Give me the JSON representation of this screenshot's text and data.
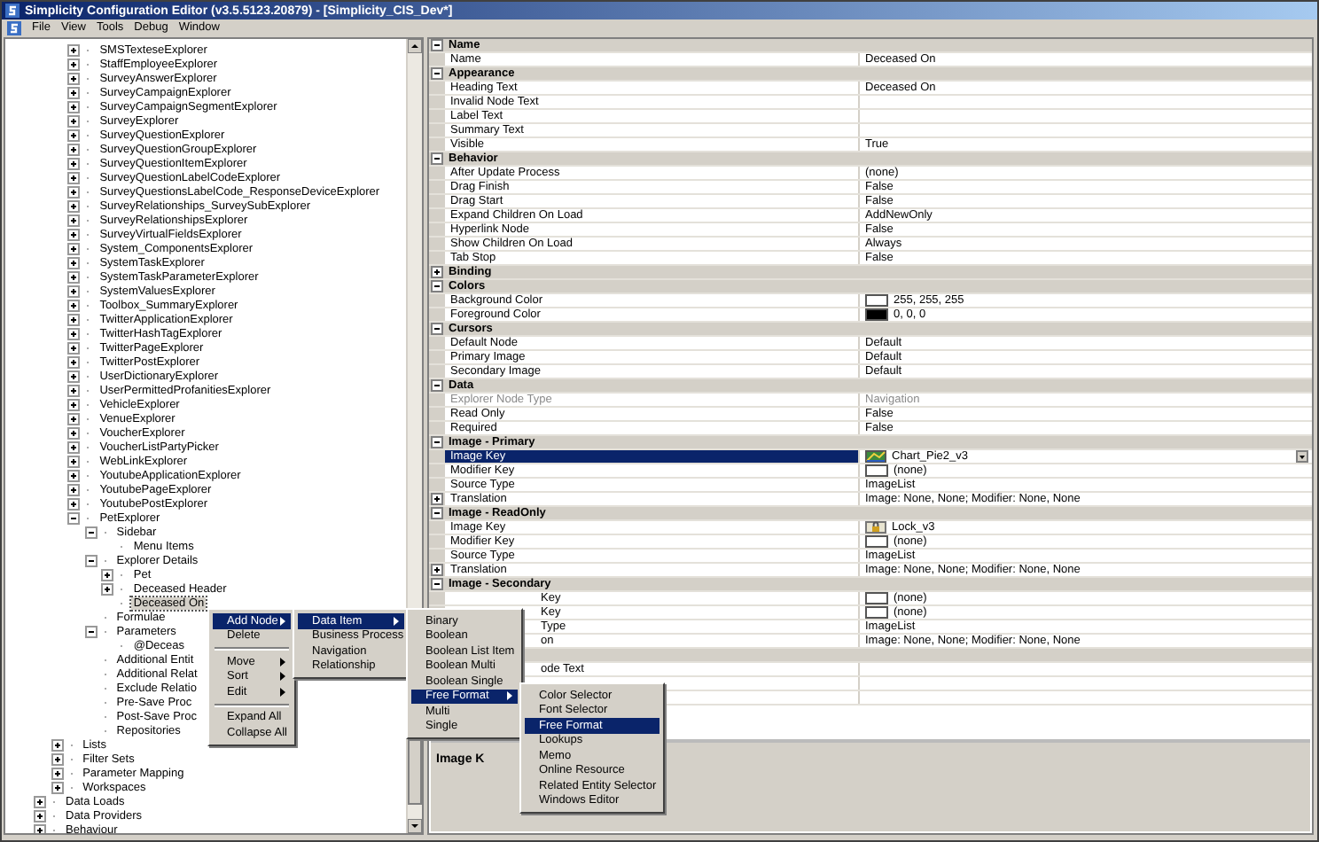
{
  "window": {
    "title": "Simplicity Configuration Editor (v3.5.5123.20879) - [Simplicity_CIS_Dev*]"
  },
  "menu_bar": [
    "File",
    "View",
    "Tools",
    "Debug",
    "Window"
  ],
  "tree": {
    "items": [
      {
        "children": [
          {
            "children": [
              {
                "label": "SMSTexteseExplorer",
                "expanded": false,
                "selected": false
              },
              {
                "label": "StaffEmployeeExplorer",
                "expanded": false,
                "selected": false
              },
              {
                "label": "SurveyAnswerExplorer",
                "expanded": false,
                "selected": false
              },
              {
                "label": "SurveyCampaignExplorer",
                "expanded": false,
                "selected": false
              },
              {
                "label": "SurveyCampaignSegmentExplorer",
                "expanded": false,
                "selected": false
              },
              {
                "label": "SurveyExplorer",
                "expanded": false,
                "selected": false
              },
              {
                "label": "SurveyQuestionExplorer",
                "expanded": false,
                "selected": false
              },
              {
                "label": "SurveyQuestionGroupExplorer",
                "expanded": false,
                "selected": false
              },
              {
                "label": "SurveyQuestionItemExplorer",
                "expanded": false,
                "selected": false
              },
              {
                "label": "SurveyQuestionLabelCodeExplorer",
                "expanded": false,
                "selected": false
              },
              {
                "label": "SurveyQuestionsLabelCode_ResponseDeviceExplorer",
                "expanded": false,
                "selected": false
              },
              {
                "label": "SurveyRelationships_SurveySubExplorer",
                "expanded": false,
                "selected": false
              },
              {
                "label": "SurveyRelationshipsExplorer",
                "expanded": false,
                "selected": false
              },
              {
                "label": "SurveyVirtualFieldsExplorer",
                "expanded": false,
                "selected": false
              },
              {
                "label": "System_ComponentsExplorer",
                "expanded": false,
                "selected": false
              },
              {
                "label": "SystemTaskExplorer",
                "expanded": false,
                "selected": false
              },
              {
                "label": "SystemTaskParameterExplorer",
                "expanded": false,
                "selected": false
              },
              {
                "label": "SystemValuesExplorer",
                "expanded": false,
                "selected": false
              },
              {
                "label": "Toolbox_SummaryExplorer",
                "expanded": false,
                "selected": false
              },
              {
                "label": "TwitterApplicationExplorer",
                "expanded": false,
                "selected": false
              },
              {
                "label": "TwitterHashTagExplorer",
                "expanded": false,
                "selected": false
              },
              {
                "label": "TwitterPageExplorer",
                "expanded": false,
                "selected": false
              },
              {
                "label": "TwitterPostExplorer",
                "expanded": false,
                "selected": false
              },
              {
                "label": "UserDictionaryExplorer",
                "expanded": false,
                "selected": false
              },
              {
                "label": "UserPermittedProfanitiesExplorer",
                "expanded": false,
                "selected": false
              },
              {
                "label": "VehicleExplorer",
                "expanded": false,
                "selected": false
              },
              {
                "label": "VenueExplorer",
                "expanded": false,
                "selected": false
              },
              {
                "label": "VoucherExplorer",
                "expanded": false,
                "selected": false
              },
              {
                "label": "VoucherListPartyPicker",
                "expanded": false,
                "selected": false
              },
              {
                "label": "WebLinkExplorer",
                "expanded": false,
                "selected": false
              },
              {
                "label": "YoutubeApplicationExplorer",
                "expanded": false,
                "selected": false
              },
              {
                "label": "YoutubePageExplorer",
                "expanded": false,
                "selected": false
              },
              {
                "label": "YoutubePostExplorer",
                "expanded": false,
                "selected": false
              },
              {
                "label": "PetExplorer",
                "expanded": true,
                "selected": false,
                "children": [
                  {
                    "label": "Sidebar",
                    "expanded": true,
                    "selected": false,
                    "children": [
                      {
                        "label": "Menu Items",
                        "selected": false
                      }
                    ]
                  },
                  {
                    "label": "Explorer Details",
                    "expanded": true,
                    "selected": false,
                    "children": [
                      {
                        "label": "Pet",
                        "expanded": false,
                        "selected": false
                      },
                      {
                        "label": "Deceased Header",
                        "expanded": false,
                        "selected": false
                      },
                      {
                        "label": "Deceased On",
                        "selected": true
                      }
                    ]
                  },
                  {
                    "label": "Formulae",
                    "selected": false
                  },
                  {
                    "label": "Parameters",
                    "expanded": true,
                    "selected": false,
                    "children": [
                      {
                        "label": "@Deceas",
                        "selected": false
                      }
                    ]
                  },
                  {
                    "label": "Additional Entit",
                    "selected": false
                  },
                  {
                    "label": "Additional Relat",
                    "selected": false
                  },
                  {
                    "label": "Exclude Relatio",
                    "selected": false
                  },
                  {
                    "label": "Pre-Save Proc",
                    "selected": false
                  },
                  {
                    "label": "Post-Save Proc",
                    "selected": false
                  },
                  {
                    "label": "Repositories",
                    "selected": false
                  }
                ]
              }
            ]
          },
          {
            "label": "Lists",
            "expanded": false,
            "selected": false
          },
          {
            "label": "Filter Sets",
            "expanded": false,
            "selected": false
          },
          {
            "label": "Parameter Mapping",
            "expanded": false,
            "selected": false
          },
          {
            "label": "Workspaces",
            "expanded": false,
            "selected": false
          }
        ]
      },
      {
        "label": "Data Loads",
        "expanded": false,
        "selected": false
      },
      {
        "label": "Data Providers",
        "expanded": false,
        "selected": false
      },
      {
        "label": "Behaviour",
        "expanded": false,
        "selected": false
      }
    ]
  },
  "properties": {
    "categories": [
      {
        "name": "Name",
        "expanded": true,
        "rows": [
          {
            "name": "Name",
            "value": "Deceased On",
            "kind": "text",
            "selected": false,
            "disabled": false
          }
        ]
      },
      {
        "name": "Appearance",
        "expanded": true,
        "rows": [
          {
            "name": "Heading Text",
            "value": "Deceased On",
            "kind": "text",
            "selected": false,
            "disabled": false
          },
          {
            "name": "Invalid Node Text",
            "kind": "text",
            "selected": false,
            "disabled": false
          },
          {
            "name": "Label Text",
            "kind": "text",
            "selected": false,
            "disabled": false
          },
          {
            "name": "Summary Text",
            "kind": "text",
            "selected": false,
            "disabled": false
          },
          {
            "name": "Visible",
            "value": "True",
            "kind": "text",
            "selected": false,
            "disabled": false
          }
        ]
      },
      {
        "name": "Behavior",
        "expanded": true,
        "rows": [
          {
            "name": "After Update Process",
            "value": "(none)",
            "kind": "text",
            "selected": false,
            "disabled": false
          },
          {
            "name": "Drag Finish",
            "value": "False",
            "kind": "text",
            "selected": false,
            "disabled": false
          },
          {
            "name": "Drag Start",
            "value": "False",
            "kind": "text",
            "selected": false,
            "disabled": false
          },
          {
            "name": "Expand Children On Load",
            "value": "AddNewOnly",
            "kind": "text",
            "selected": false,
            "disabled": false
          },
          {
            "name": "Hyperlink Node",
            "value": "False",
            "kind": "text",
            "selected": false,
            "disabled": false
          },
          {
            "name": "Show Children On Load",
            "value": "Always",
            "kind": "text",
            "selected": false,
            "disabled": false
          },
          {
            "name": "Tab Stop",
            "value": "False",
            "kind": "text",
            "selected": false,
            "disabled": false
          }
        ]
      },
      {
        "name": "Binding",
        "expanded": false
      },
      {
        "name": "Colors",
        "expanded": true,
        "rows": [
          {
            "name": "Background Color",
            "value": "255, 255, 255",
            "kind": "color",
            "color": "#ffffff",
            "selected": false,
            "disabled": false
          },
          {
            "name": "Foreground Color",
            "value": "0, 0, 0",
            "kind": "color",
            "color": "#000000",
            "selected": false,
            "disabled": false
          }
        ]
      },
      {
        "name": "Cursors",
        "expanded": true,
        "rows": [
          {
            "name": "Default Node",
            "value": "Default",
            "kind": "text",
            "selected": false,
            "disabled": false
          },
          {
            "name": "Primary Image",
            "value": "Default",
            "kind": "text",
            "selected": false,
            "disabled": false
          },
          {
            "name": "Secondary Image",
            "value": "Default",
            "kind": "text",
            "selected": false,
            "disabled": false
          }
        ]
      },
      {
        "name": "Data",
        "expanded": true,
        "rows": [
          {
            "name": "Explorer Node Type",
            "value": "Navigation",
            "kind": "text",
            "selected": false,
            "disabled": true
          },
          {
            "name": "Read Only",
            "value": "False",
            "kind": "text",
            "selected": false,
            "disabled": false
          },
          {
            "name": "Required",
            "value": "False",
            "kind": "text",
            "selected": false,
            "disabled": false
          }
        ]
      },
      {
        "name": "Image - Primary",
        "expanded": true,
        "rows": [
          {
            "name": "Image Key",
            "value": "Chart_Pie2_v3",
            "kind": "chart-image",
            "selected": true,
            "disabled": false
          },
          {
            "name": "Modifier Key",
            "value": "(none)",
            "kind": "no-image",
            "selected": false,
            "disabled": false
          },
          {
            "name": "Source Type",
            "value": "ImageList",
            "kind": "text",
            "selected": false,
            "disabled": false
          },
          {
            "name": "Translation",
            "value": "Image: None, None; Modifier: None, None",
            "kind": "text",
            "expanded": false,
            "selected": false,
            "disabled": false
          }
        ]
      },
      {
        "name": "Image - ReadOnly",
        "expanded": true,
        "rows": [
          {
            "name": "Image Key",
            "value": "Lock_v3",
            "kind": "lock-image",
            "selected": false,
            "disabled": false
          },
          {
            "name": "Modifier Key",
            "value": "(none)",
            "kind": "no-image",
            "selected": false,
            "disabled": false
          },
          {
            "name": "Source Type",
            "value": "ImageList",
            "kind": "text",
            "selected": false,
            "disabled": false
          },
          {
            "name": "Translation",
            "value": "Image: None, None; Modifier: None, None",
            "kind": "text",
            "expanded": false,
            "selected": false,
            "disabled": false
          }
        ]
      },
      {
        "name": "Image - Secondary",
        "expanded": true,
        "rows": [
          {
            "name": "Key",
            "value": "(none)",
            "kind": "no-image",
            "covered": true,
            "selected": false,
            "disabled": false
          },
          {
            "name": "Key",
            "value": "(none)",
            "kind": "no-image",
            "covered": true,
            "selected": false,
            "disabled": false
          },
          {
            "name": "Type",
            "value": "ImageList",
            "kind": "text",
            "covered": true,
            "selected": false,
            "disabled": false
          },
          {
            "name": "on",
            "value": "Image: None, None; Modifier: None, None",
            "kind": "text",
            "covered": true,
            "selected": false,
            "disabled": false
          }
        ]
      },
      {
        "rows": [
          {
            "name": "ode Text",
            "kind": "text",
            "covered": true,
            "selected": false,
            "disabled": false
          },
          {
            "kind": "text",
            "selected": false
          },
          {
            "kind": "text",
            "selected": false
          }
        ]
      }
    ]
  },
  "description": {
    "title": "Image K"
  },
  "context_menus": [
    {
      "items": [
        {
          "kind": "item",
          "label": "Add Node",
          "has_submenu": true,
          "selected": true
        },
        {
          "kind": "item",
          "label": "Delete",
          "has_submenu": false,
          "selected": false
        },
        {
          "kind": "separator"
        },
        {
          "kind": "item",
          "label": "Move",
          "has_submenu": true,
          "selected": false
        },
        {
          "kind": "item",
          "label": "Sort",
          "has_submenu": true,
          "selected": false
        },
        {
          "kind": "item",
          "label": "Edit",
          "has_submenu": true,
          "selected": false
        },
        {
          "kind": "separator"
        },
        {
          "kind": "item",
          "label": "Expand All",
          "has_submenu": false,
          "selected": false
        },
        {
          "kind": "item",
          "label": "Collapse All",
          "has_submenu": false,
          "selected": false
        }
      ]
    },
    {
      "items": [
        {
          "kind": "item",
          "label": "Data Item",
          "has_submenu": true,
          "selected": true
        },
        {
          "kind": "item",
          "label": "Business Process",
          "has_submenu": false,
          "selected": false
        },
        {
          "kind": "item",
          "label": "Navigation",
          "has_submenu": false,
          "selected": false
        },
        {
          "kind": "item",
          "label": "Relationship",
          "has_submenu": false,
          "selected": false
        }
      ]
    },
    {
      "items": [
        {
          "kind": "item",
          "label": "Binary",
          "has_submenu": false,
          "selected": false
        },
        {
          "kind": "item",
          "label": "Boolean",
          "has_submenu": false,
          "selected": false
        },
        {
          "kind": "item",
          "label": "Boolean List Item",
          "has_submenu": false,
          "selected": false
        },
        {
          "kind": "item",
          "label": "Boolean Multi",
          "has_submenu": false,
          "selected": false
        },
        {
          "kind": "item",
          "label": "Boolean Single",
          "has_submenu": false,
          "selected": false
        },
        {
          "kind": "item",
          "label": "Free Format",
          "has_submenu": true,
          "selected": true
        },
        {
          "kind": "item",
          "label": "Multi",
          "has_submenu": false,
          "selected": false
        },
        {
          "kind": "item",
          "label": "Single",
          "has_submenu": false,
          "selected": false
        }
      ]
    },
    {
      "items": [
        {
          "kind": "item",
          "label": "Color Selector",
          "has_submenu": false,
          "selected": false
        },
        {
          "kind": "item",
          "label": "Font Selector",
          "has_submenu": false,
          "selected": false
        },
        {
          "kind": "item",
          "label": "Free Format",
          "has_submenu": false,
          "selected": true
        },
        {
          "kind": "item",
          "label": "Lookups",
          "has_submenu": false,
          "selected": false
        },
        {
          "kind": "item",
          "label": "Memo",
          "has_submenu": false,
          "selected": false
        },
        {
          "kind": "item",
          "label": "Online Resource",
          "has_submenu": false,
          "selected": false
        },
        {
          "kind": "item",
          "label": "Related Entity Selector",
          "has_submenu": false,
          "selected": false
        },
        {
          "kind": "item",
          "label": "Windows Editor",
          "has_submenu": false,
          "selected": false
        }
      ]
    }
  ]
}
